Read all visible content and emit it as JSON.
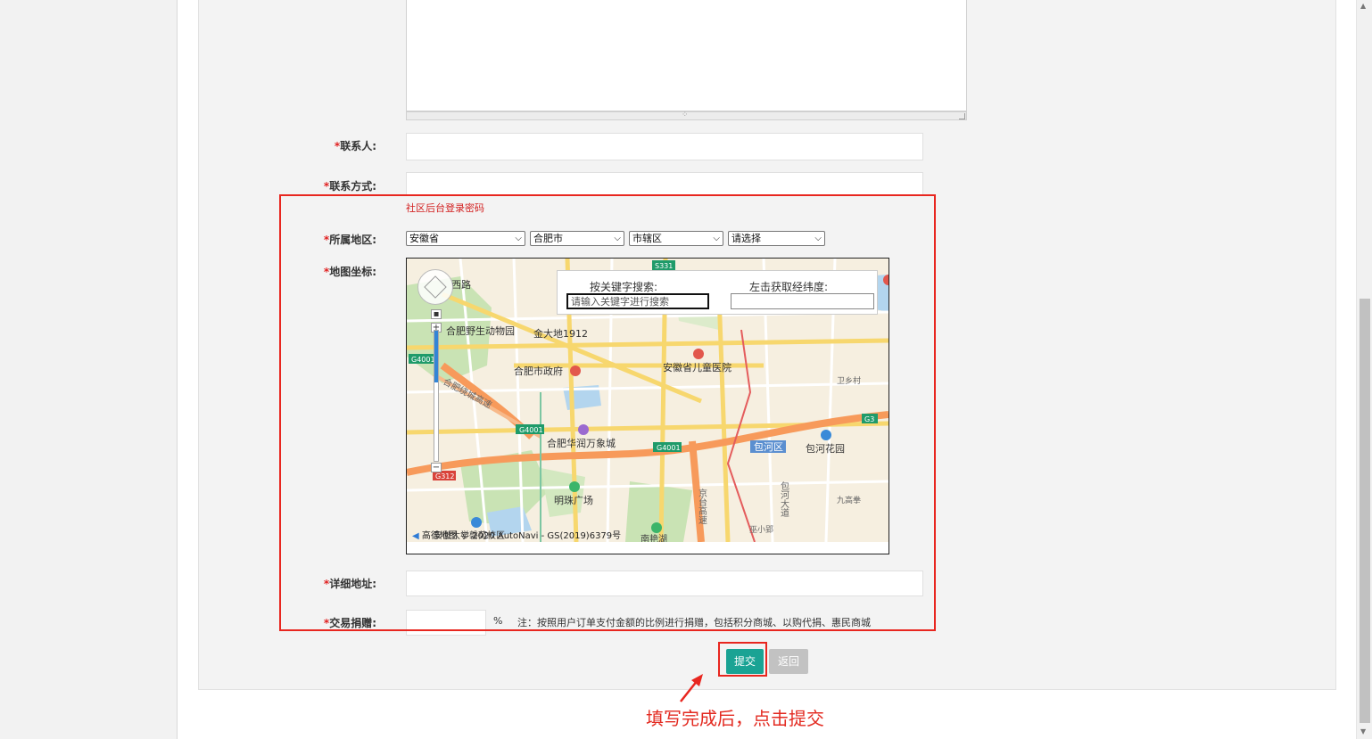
{
  "form": {
    "contact_person_label": "联系人:",
    "contact_info_label": "联系方式:",
    "required_mark": "*",
    "hint": "社区后台登录密码",
    "region_label": "所属地区:",
    "region_selects": [
      "安徽省",
      "合肥市",
      "市辖区",
      "请选择"
    ],
    "map_label": "地图坐标:",
    "address_label": "详细地址:",
    "donation_label": "交易捐赠:",
    "donation_unit": "%",
    "donation_note": "注：按照用户订单支付金额的比例进行捐赠，包括积分商城、以购代捐、惠民商城"
  },
  "map": {
    "search_title": "按关键字搜索:",
    "search_placeholder": "请输入关键字进行搜索",
    "coord_title": "左击获取经纬度:",
    "coord_value": "",
    "copyright": "高德地图 © 2020 AutoNavi - GS(2019)6379号",
    "zoom_level": 0.4,
    "places": [
      "合肥野生动物园",
      "金大地1912",
      "合肥市政府",
      "安徽省儿童医院",
      "合肥华润万象城",
      "包河区",
      "包河花园",
      "明珠广场",
      "卫乡村",
      "九高拳",
      "巫小郢",
      "西路",
      "合肥绕城高速",
      "京台高速",
      "包河大道",
      "安徽大学磬苑校区",
      "南艳湖"
    ],
    "road_shields": [
      "S331",
      "G4001",
      "G4001",
      "G4001",
      "G3",
      "G312"
    ],
    "colors": {
      "land": "#f6efe0",
      "green": "#c9e3b4",
      "water": "#b3d5ee",
      "expressway": "#f79a5b",
      "main_road": "#f7d76e",
      "shield": "#1f9b6a",
      "shield_red": "#d9433b"
    }
  },
  "buttons": {
    "submit": "提交",
    "back": "返回"
  },
  "annotation": {
    "callout": "填写完成后，点击提交",
    "color": "#e8261f"
  }
}
